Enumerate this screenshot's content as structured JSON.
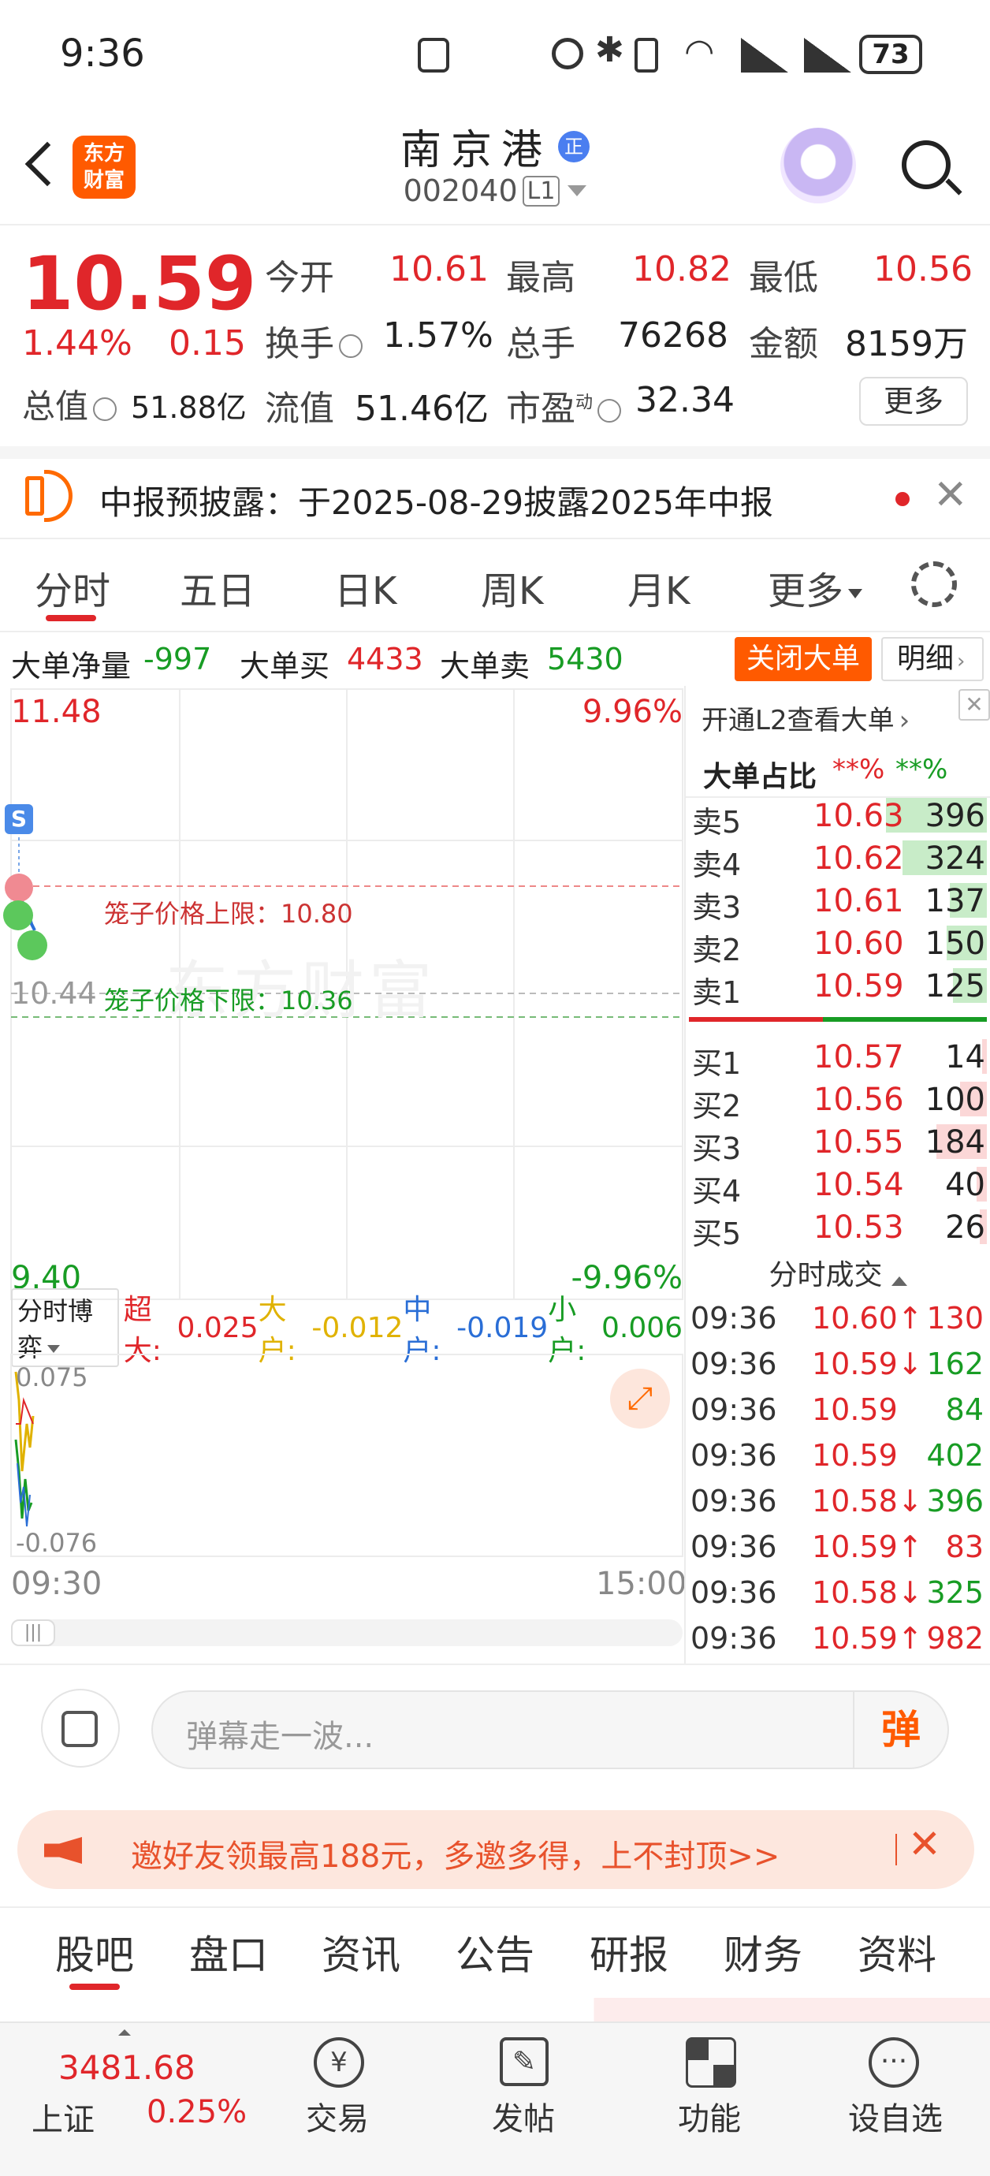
{
  "status_bar": {
    "time": "9:36",
    "battery": "73"
  },
  "header": {
    "back_icon": "chevron-left-icon",
    "logo_text": "东方\n财富",
    "stock_name": "南京港",
    "name_badge": "正",
    "stock_code": "002040",
    "level_badge": "L1"
  },
  "quote": {
    "price": "10.59",
    "change_pct": "1.44%",
    "change_amt": "0.15",
    "open_label": "今开",
    "open": "10.61",
    "high_label": "最高",
    "high": "10.82",
    "low_label": "最低",
    "low": "10.56",
    "turnover_label": "换手",
    "turnover": "1.57%",
    "volume_label": "总手",
    "volume": "76268",
    "amount_label": "金额",
    "amount": "8159万",
    "mktcap_label": "总值",
    "mktcap": "51.88亿",
    "float_label": "流值",
    "float": "51.46亿",
    "pe_label": "市盈",
    "pe_sup": "动",
    "pe": "32.34",
    "more_button": "更多"
  },
  "notice": {
    "text": "中报预披露：于2025-08-29披露2025年中报"
  },
  "chart_tabs": [
    "分时",
    "五日",
    "日K",
    "周K",
    "月K",
    "更多"
  ],
  "big_order": {
    "net_label": "大单净量",
    "net": "-997",
    "buy_label": "大单买",
    "buy": "4433",
    "sell_label": "大单卖",
    "sell": "5430",
    "close_button": "关闭大单",
    "detail_button": "明细"
  },
  "intraday": {
    "top_price": "11.48",
    "top_pct": "9.96%",
    "bottom_price": "9.40",
    "bottom_pct": "-9.96%",
    "prev_close": "10.44",
    "cage_upper": "笼子价格上限：10.80",
    "cage_lower": "笼子价格下限：10.36",
    "watermark": "东方财富",
    "time_start": "09:30",
    "time_end": "15:00",
    "s_marker": "S"
  },
  "flow": {
    "selector": "分时博弈",
    "super_label": "超大:",
    "super": "0.025",
    "large_label": "大户:",
    "large": "-0.012",
    "mid_label": "中户:",
    "mid": "-0.019",
    "small_label": "小户:",
    "small": "0.006",
    "max": "0.075",
    "min": "-0.076"
  },
  "orderbook": {
    "l2_link": "开通L2查看大单",
    "ratio_label": "大单占比",
    "ratio_sell": "**%",
    "ratio_buy": "**%",
    "asks": [
      {
        "label": "卖5",
        "price": "10.63",
        "vol": "396",
        "bar": 0.6
      },
      {
        "label": "卖4",
        "price": "10.62",
        "vol": "324",
        "bar": 0.5
      },
      {
        "label": "卖3",
        "price": "10.61",
        "vol": "137",
        "bar": 0.22
      },
      {
        "label": "卖2",
        "price": "10.60",
        "vol": "150",
        "bar": 0.24
      },
      {
        "label": "卖1",
        "price": "10.59",
        "vol": "125",
        "bar": 0.2
      }
    ],
    "bids": [
      {
        "label": "买1",
        "price": "10.57",
        "vol": "14",
        "bar": 0.03
      },
      {
        "label": "买2",
        "price": "10.56",
        "vol": "100",
        "bar": 0.16
      },
      {
        "label": "买3",
        "price": "10.55",
        "vol": "184",
        "bar": 0.3
      },
      {
        "label": "买4",
        "price": "10.54",
        "vol": "40",
        "bar": 0.06
      },
      {
        "label": "买5",
        "price": "10.53",
        "vol": "26",
        "bar": 0.04
      }
    ],
    "trades_title": "分时成交",
    "trades": [
      {
        "time": "09:36",
        "price": "10.60↑",
        "vol": "130",
        "dir": "up"
      },
      {
        "time": "09:36",
        "price": "10.59↓",
        "vol": "162",
        "dir": "down"
      },
      {
        "time": "09:36",
        "price": "10.59",
        "vol": "84",
        "dir": "down"
      },
      {
        "time": "09:36",
        "price": "10.59",
        "vol": "402",
        "dir": "down"
      },
      {
        "time": "09:36",
        "price": "10.58↓",
        "vol": "396",
        "dir": "down"
      },
      {
        "time": "09:36",
        "price": "10.59↑",
        "vol": "83",
        "dir": "up"
      },
      {
        "time": "09:36",
        "price": "10.58↓",
        "vol": "325",
        "dir": "down"
      },
      {
        "time": "09:36",
        "price": "10.59↑",
        "vol": "982",
        "dir": "up"
      }
    ]
  },
  "comment": {
    "placeholder": "弹幕走一波...",
    "danmu_button": "弹"
  },
  "promo": {
    "text": "邀好友领最高188元，多邀多得，上不封顶>>"
  },
  "bottom_tabs": [
    "股吧",
    "盘口",
    "资讯",
    "公告",
    "研报",
    "财务",
    "资料"
  ],
  "nav": {
    "index_value": "3481.68",
    "index_name": "上证",
    "index_pct": "0.25%",
    "items": [
      "交易",
      "发帖",
      "功能",
      "设自选"
    ]
  },
  "colors": {
    "up": "#e0262a",
    "down": "#189c24",
    "brand": "#ff5a00"
  }
}
